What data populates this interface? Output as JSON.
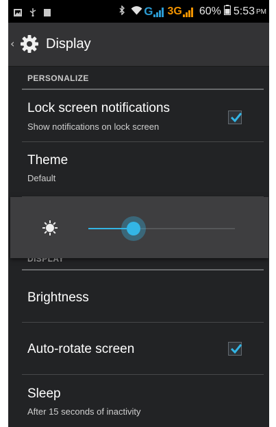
{
  "status_bar": {
    "network_g": "G",
    "network_3g": "3G",
    "battery_percent": "60%",
    "time": "5:53",
    "ampm": "PM",
    "icons": [
      "gallery-icon",
      "usb-icon",
      "sd-card-icon",
      "bluetooth-icon",
      "wifi-icon",
      "signal-icon",
      "battery-icon"
    ]
  },
  "action_bar": {
    "back_icon": "chevron-left-icon",
    "app_icon": "gear-icon",
    "title": "Display"
  },
  "sections": {
    "personalize_header": "PERSONALIZE",
    "display_header_partial": "DISPLAY"
  },
  "settings": [
    {
      "title": "Lock screen notifications",
      "summary": "Show notifications on lock screen",
      "checked": true
    },
    {
      "title": "Theme",
      "summary": "Default"
    },
    {
      "title": "Brightness"
    },
    {
      "title": "Auto-rotate screen",
      "checked": true
    },
    {
      "title": "Sleep",
      "summary": "After 15 seconds of inactivity"
    }
  ],
  "brightness_dialog": {
    "icon": "sun-icon",
    "level": 0.31
  },
  "colors": {
    "accent": "#33b5e5",
    "background": "#222325",
    "status_bar": "#000000",
    "action_bar": "#333335",
    "network_g": "#2b9bd3",
    "network_3g": "#f29300"
  }
}
